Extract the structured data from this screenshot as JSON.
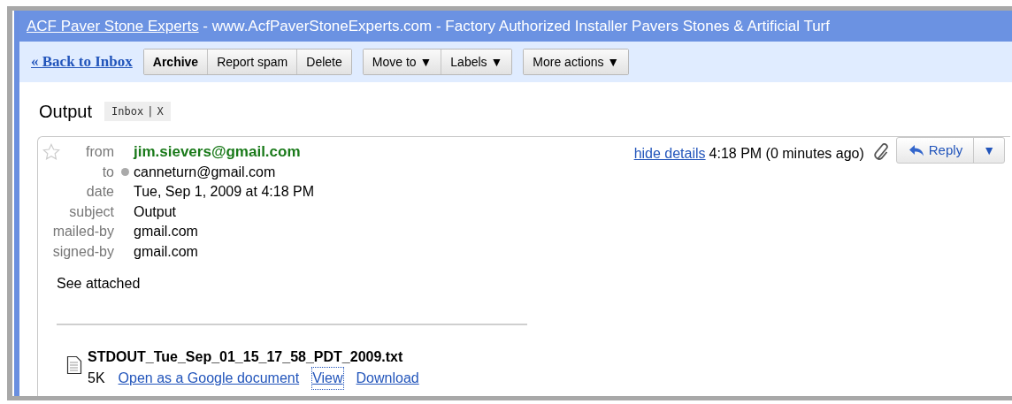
{
  "header": {
    "link": "ACF Paver Stone Experts",
    "text": " - www.AcfPaverStoneExperts.com - Factory Authorized Installer Pavers Stones & Artificial Turf"
  },
  "toolbar": {
    "back_link": "« Back to Inbox",
    "groups": [
      [
        {
          "label": "Archive",
          "bold": true
        },
        {
          "label": "Report spam",
          "bold": false
        },
        {
          "label": "Delete",
          "bold": false
        }
      ],
      [
        {
          "label": "Move to ▼",
          "bold": false
        },
        {
          "label": "Labels ▼",
          "bold": false
        }
      ],
      [
        {
          "label": "More actions ▼",
          "bold": false
        }
      ]
    ]
  },
  "subject": "Output",
  "label_tag": {
    "label": "Inbox",
    "separator": "|",
    "remove": "X"
  },
  "message": {
    "starred": false,
    "fields": [
      {
        "kind": "sender",
        "label": "from",
        "value": "jim.sievers@gmail.com"
      },
      {
        "kind": "contact",
        "label": "to",
        "value": "canneturn@gmail.com"
      },
      {
        "kind": "plain",
        "label": "date",
        "value": "Tue, Sep 1, 2009 at 4:18 PM"
      },
      {
        "kind": "plain",
        "label": "subject",
        "value": "Output"
      },
      {
        "kind": "plain",
        "label": "mailed-by",
        "value": "gmail.com"
      },
      {
        "kind": "plain",
        "label": "signed-by",
        "value": "gmail.com"
      }
    ],
    "hide_details": "hide details",
    "time": "4:18 PM (0 minutes ago)",
    "has_attachment": true,
    "reply": "Reply",
    "more": "▼",
    "body": "See attached",
    "attachment": {
      "name": "STDOUT_Tue_Sep_01_15_17_58_PDT_2009.txt",
      "size": "5K",
      "links": [
        {
          "label": "Open as a Google document",
          "focused": false
        },
        {
          "label": "View",
          "focused": true
        },
        {
          "label": "Download",
          "focused": false
        }
      ]
    }
  }
}
